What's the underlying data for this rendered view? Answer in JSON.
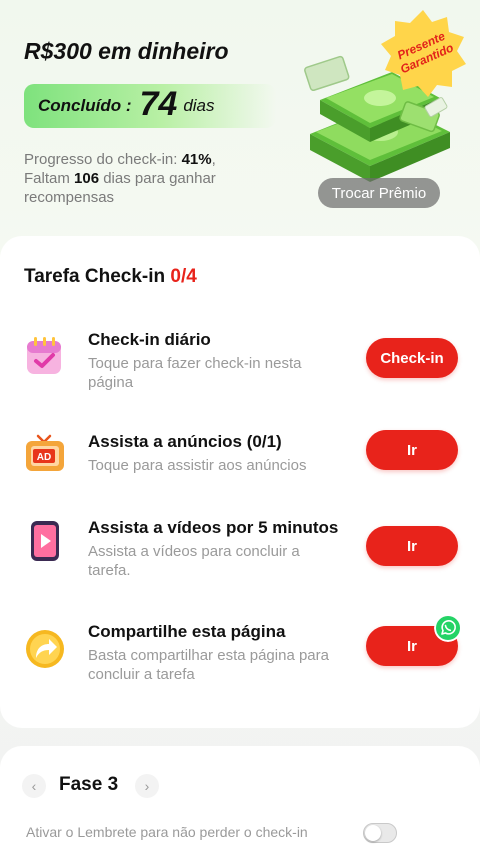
{
  "hero": {
    "title": "R$300 em dinheiro",
    "done_label": "Concluído :",
    "done_days": "74",
    "done_unit": "dias",
    "progress_prefix": "Progresso do check-in: ",
    "progress_percent": "41%",
    "progress_suffix": ",",
    "remaining_prefix": "Faltam ",
    "remaining_days": "106",
    "remaining_suffix": " dias para ganhar recompensas",
    "badge_line1": "Presente",
    "badge_line2": "Garantido",
    "swap_button": "Trocar Prêmio"
  },
  "tasks": {
    "header": "Tarefa Check-in ",
    "count": "0/4",
    "items": [
      {
        "title": "Check-in diário",
        "desc": "Toque para fazer check-in nesta página",
        "button": "Check-in",
        "icon": "calendar-icon"
      },
      {
        "title": "Assista a anúncios  (0/1)",
        "desc": "Toque para assistir aos anúncios",
        "button": "Ir",
        "icon": "ad-tv-icon"
      },
      {
        "title": "Assista a vídeos por 5 minutos",
        "desc": "Assista a vídeos para concluir a tarefa.",
        "button": "Ir",
        "icon": "video-phone-icon"
      },
      {
        "title": "Compartilhe esta página",
        "desc": "Basta compartilhar esta página para concluir a tarefa",
        "button": "Ir",
        "icon": "share-icon"
      }
    ]
  },
  "phase": {
    "label": "Fase 3",
    "prev": "‹",
    "next": "›",
    "reminder": "Ativar o Lembrete para não perder o check-in",
    "reminder_on": false
  },
  "colors": {
    "accent_red": "#e8231b",
    "progress_green": "#7ee27d",
    "whatsapp_green": "#25d366"
  }
}
